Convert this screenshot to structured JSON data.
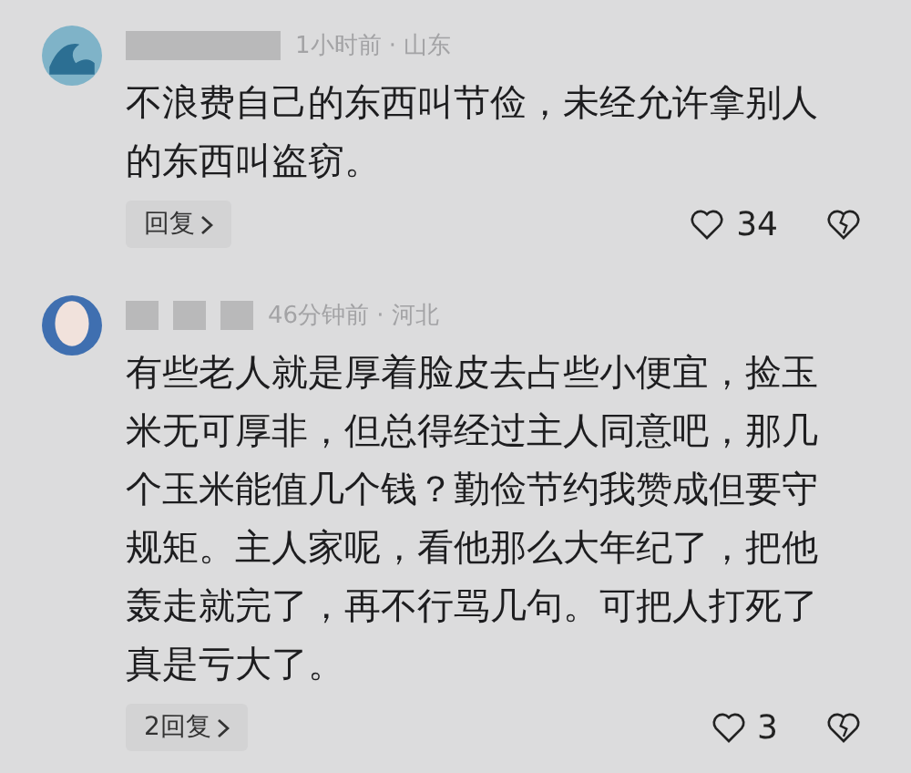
{
  "comments": [
    {
      "kind": "wave",
      "meta": "1小时前 · 山东",
      "text": "不浪费自己的东西叫节俭，未经允许拿别人的东西叫盗窃。",
      "reply_label": "回复",
      "likes": "34"
    },
    {
      "kind": "person",
      "meta": "46分钟前 · 河北",
      "text": "有些老人就是厚着脸皮去占些小便宜，捡玉米无可厚非，但总得经过主人同意吧，那几个玉米能值几个钱？勤俭节约我赞成但要守规矩。主人家呢，看他那么大年纪了，把他轰走就完了，再不行骂几句。可把人打死了真是亏大了。",
      "reply_label": "2回复",
      "likes": "3"
    }
  ]
}
